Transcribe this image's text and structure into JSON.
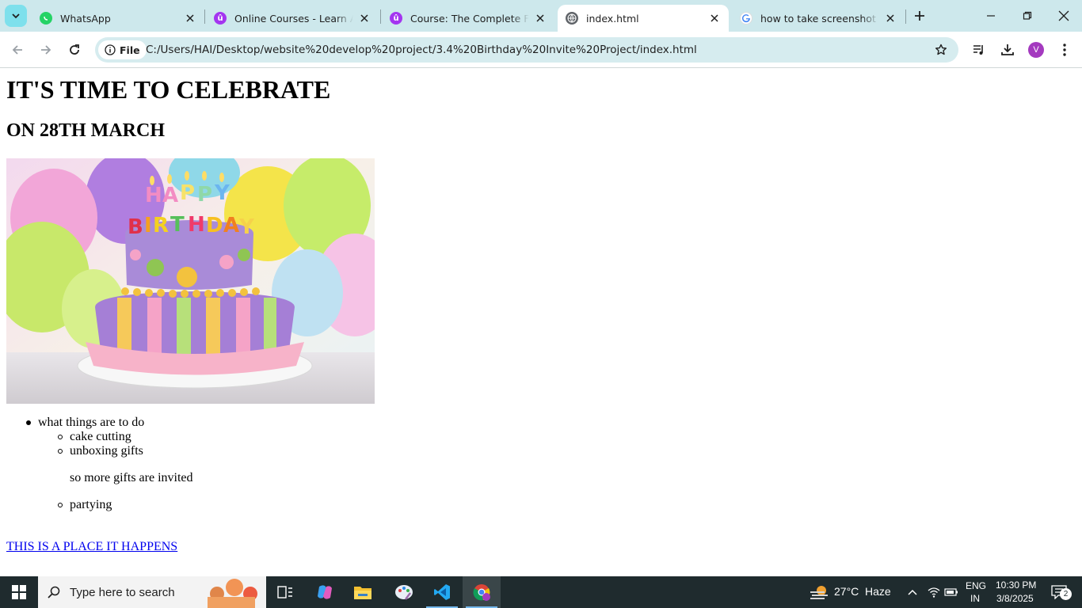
{
  "browser": {
    "tabs": [
      {
        "title": "WhatsApp",
        "favicon": "whatsapp-icon"
      },
      {
        "title": "Online Courses - Learn Anything",
        "favicon": "udemy-icon"
      },
      {
        "title": "Course: The Complete Full-Stack",
        "favicon": "udemy-icon"
      },
      {
        "title": "index.html",
        "favicon": "globe-icon",
        "active": true
      },
      {
        "title": "how to take screenshot in laptop",
        "favicon": "google-icon"
      }
    ],
    "site_chip_label": "File",
    "url": "C:/Users/HAI/Desktop/website%20develop%20project/3.4%20Birthday%20Invite%20Project/index.html",
    "profile_initial": "V"
  },
  "page": {
    "heading1": "IT'S TIME TO CELEBRATE",
    "heading2": "ON 28TH MARCH",
    "image_alt": "Birthday cake with Happy Birthday candles",
    "list": {
      "item": "what things are to do",
      "subitems": [
        "cake cutting",
        "unboxing gifts",
        "partying"
      ],
      "note": "so more gifts are invited"
    },
    "link_text": "THIS IS A PLACE IT HAPPENS"
  },
  "taskbar": {
    "search_placeholder": "Type here to search",
    "weather": {
      "temp": "27°C",
      "condition": "Haze"
    },
    "language": {
      "line1": "ENG",
      "line2": "IN"
    },
    "time": "10:30 PM",
    "date": "3/8/2025",
    "notification_count": "2"
  },
  "colors": {
    "tabstrip_bg": "#cde8ec",
    "omnibox_bg": "#d6ecef",
    "link_color": "#0000ee",
    "taskbar_bg": "#1f2b2e"
  }
}
